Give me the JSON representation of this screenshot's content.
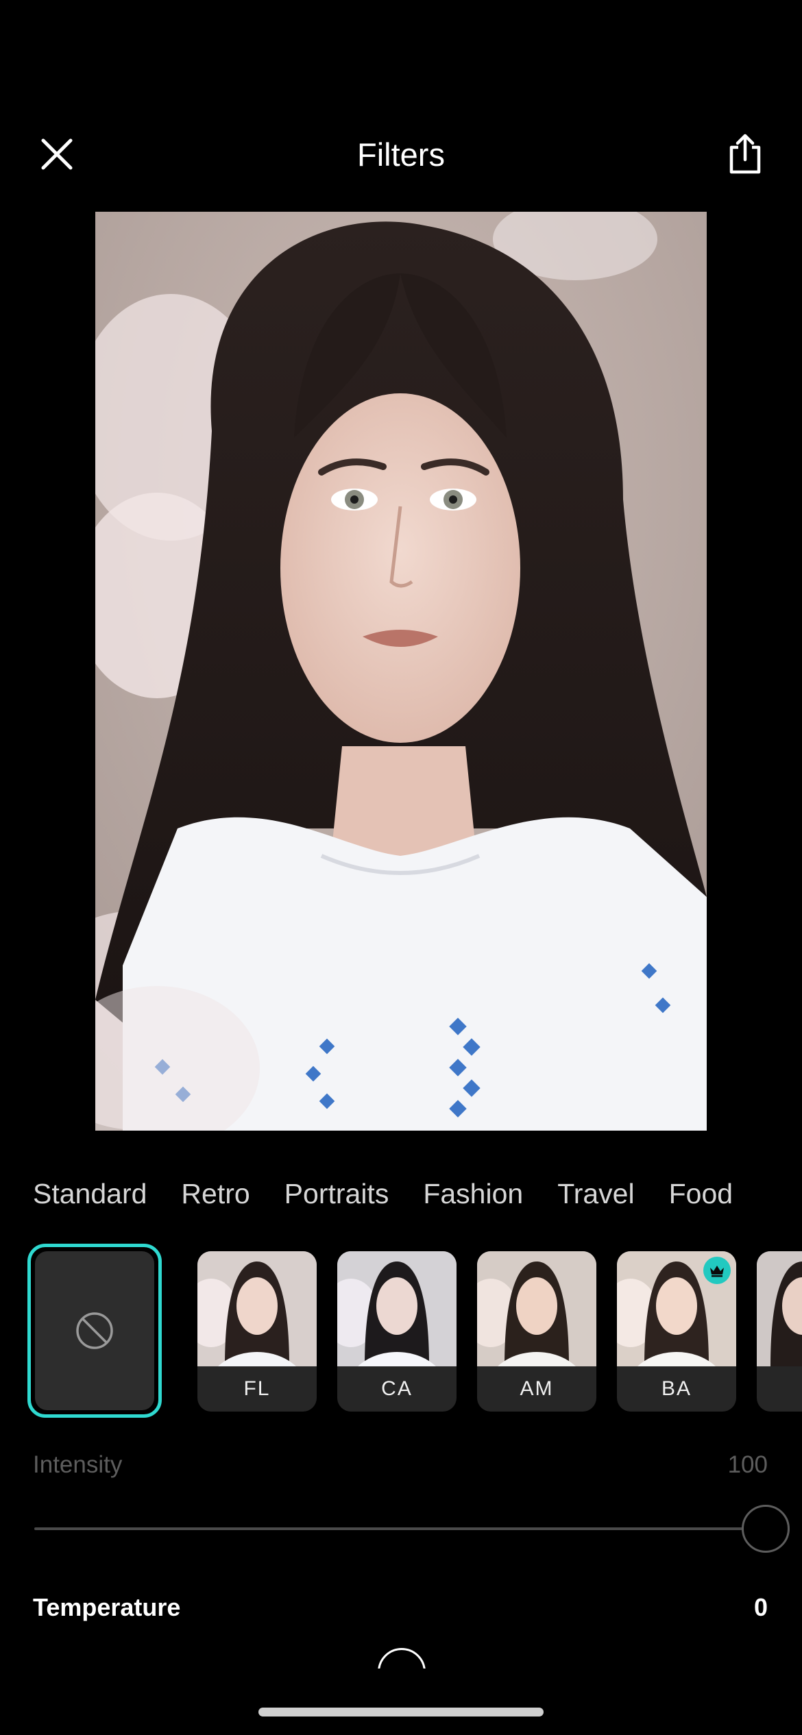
{
  "header": {
    "title": "Filters",
    "close_icon": "close-icon",
    "share_icon": "share-icon"
  },
  "photo": {
    "description_icon": "portrait-photo"
  },
  "tabs": [
    {
      "label": "Standard"
    },
    {
      "label": "Retro"
    },
    {
      "label": "Portraits"
    },
    {
      "label": "Fashion"
    },
    {
      "label": "Travel"
    },
    {
      "label": "Food"
    }
  ],
  "filters": {
    "none_icon": "no-filter-icon",
    "items": [
      {
        "label": "FL",
        "premium": false
      },
      {
        "label": "CA",
        "premium": false
      },
      {
        "label": "AM",
        "premium": false
      },
      {
        "label": "BA",
        "premium": true
      },
      {
        "label": "",
        "premium": false
      }
    ]
  },
  "intensity": {
    "label": "Intensity",
    "value": "100",
    "level": 1.0
  },
  "temperature": {
    "label": "Temperature",
    "value": "0"
  },
  "colors": {
    "accent": "#2fd9d0",
    "crown_badge": "#22c9c0",
    "background": "#000000"
  }
}
